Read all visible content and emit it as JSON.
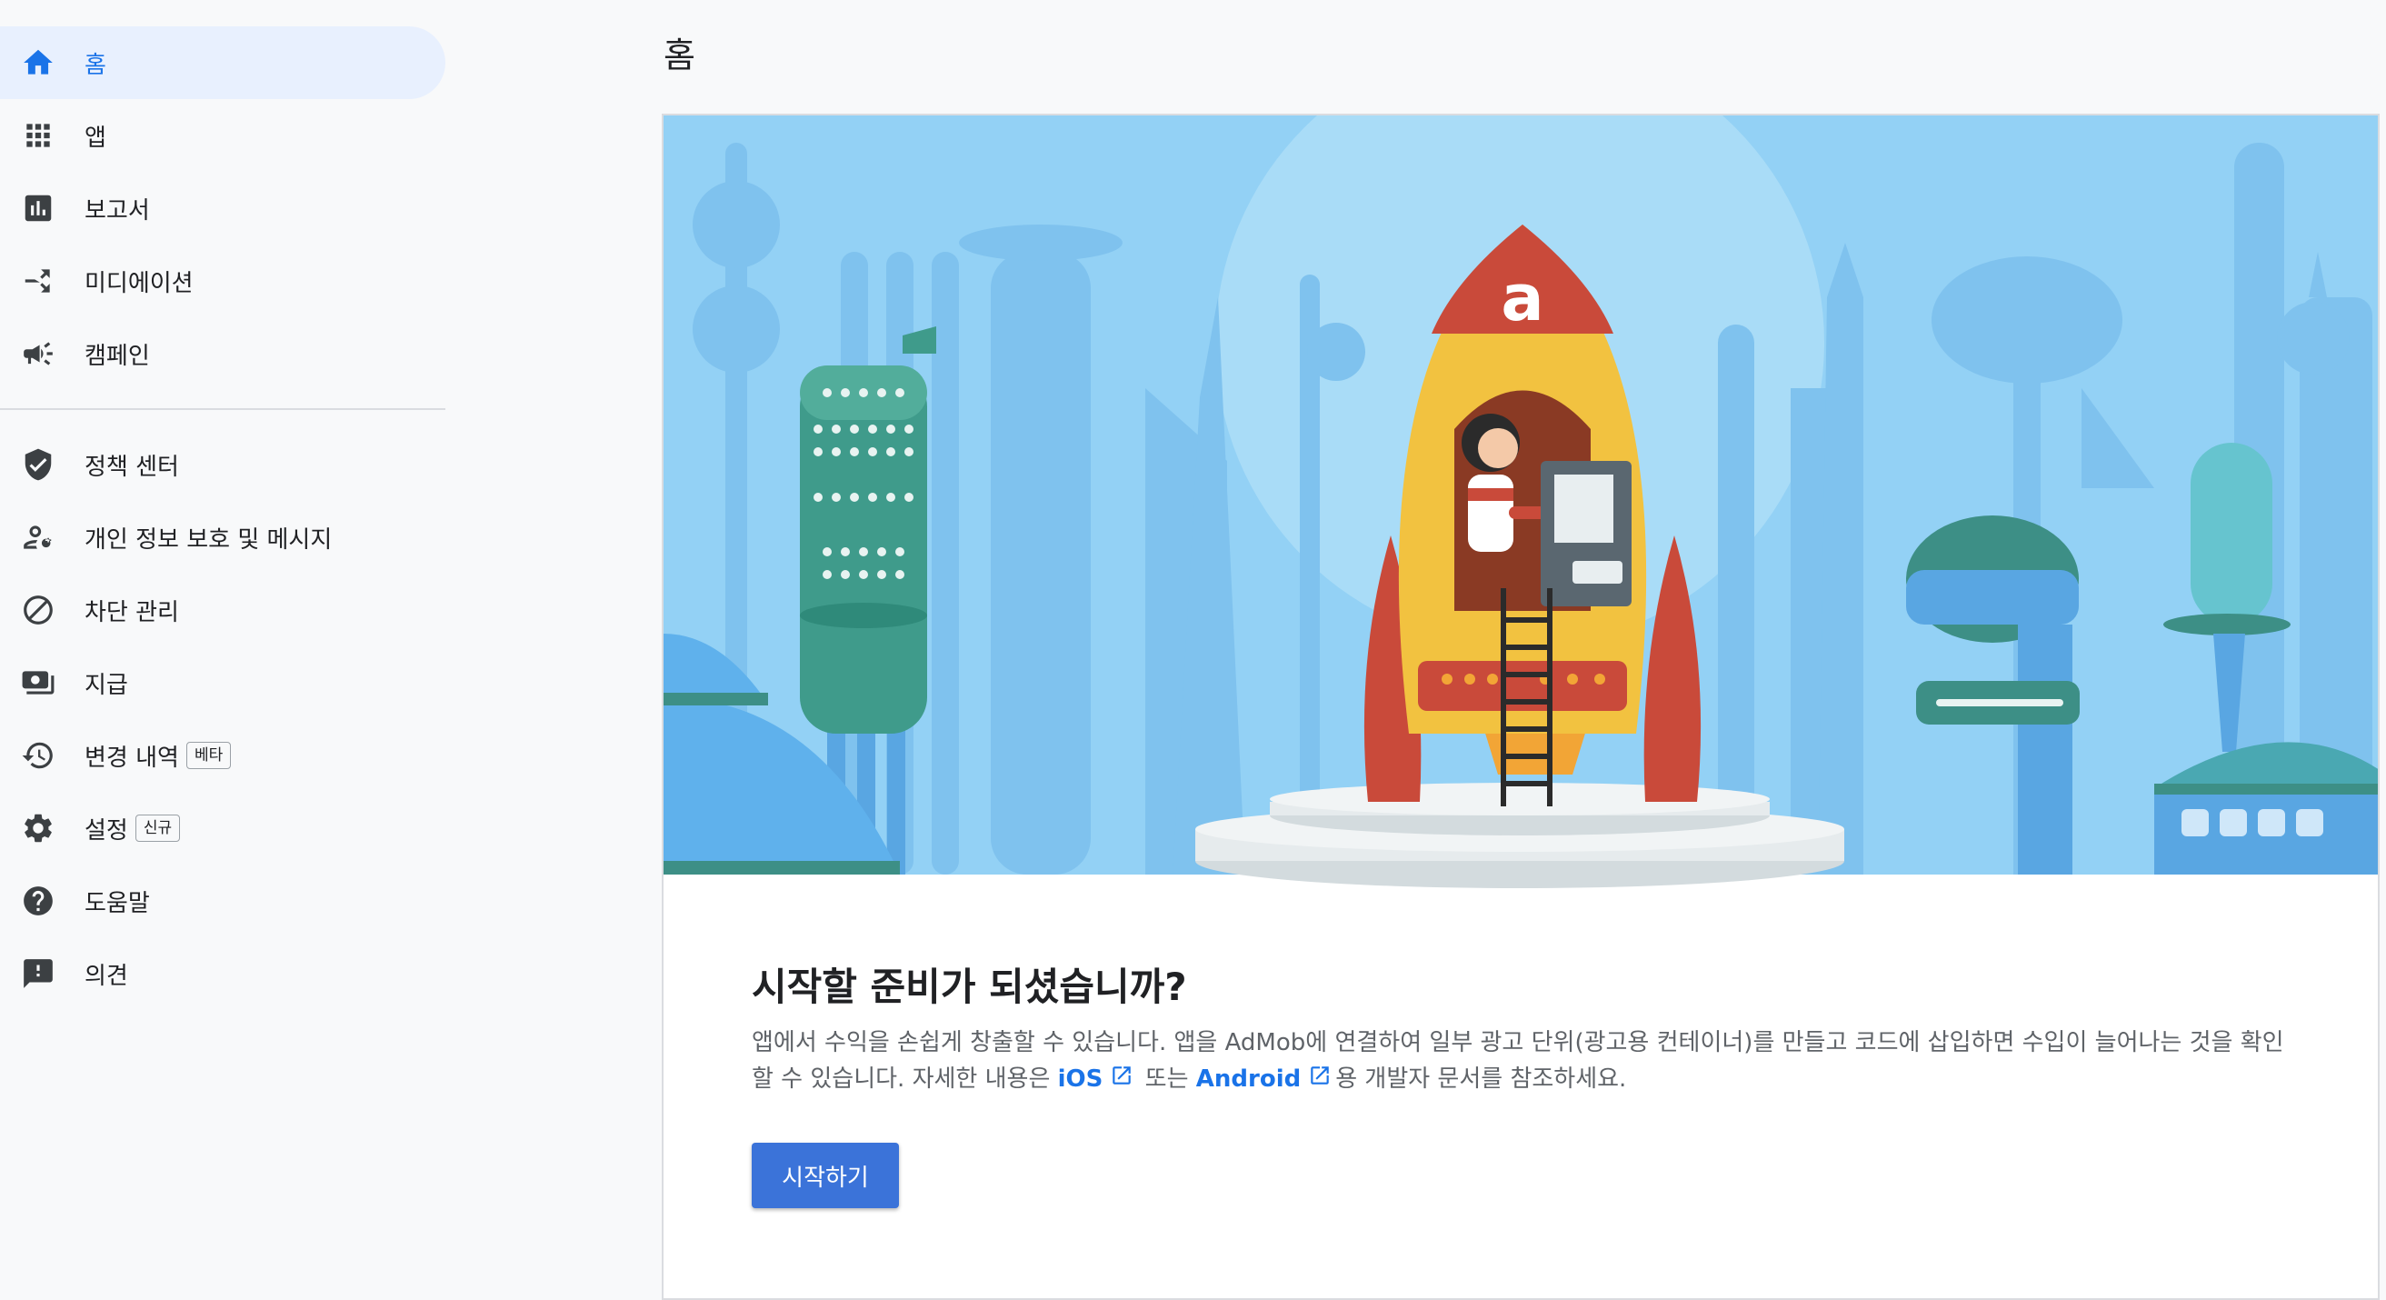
{
  "sidebar": {
    "items": [
      {
        "label": "홈",
        "icon": "home-icon",
        "active": true
      },
      {
        "label": "앱",
        "icon": "apps-grid-icon"
      },
      {
        "label": "보고서",
        "icon": "bar-chart-icon"
      },
      {
        "label": "미디에이션",
        "icon": "call-split-icon"
      },
      {
        "label": "캠페인",
        "icon": "megaphone-icon"
      },
      {
        "label": "정책 센터",
        "icon": "shield-check-icon"
      },
      {
        "label": "개인 정보 보호 및 메시지",
        "icon": "person-settings-icon"
      },
      {
        "label": "차단 관리",
        "icon": "block-icon"
      },
      {
        "label": "지급",
        "icon": "payments-icon"
      },
      {
        "label": "변경 내역",
        "icon": "history-icon",
        "tag": "베타"
      },
      {
        "label": "설정",
        "icon": "gear-icon",
        "tag": "신규"
      },
      {
        "label": "도움말",
        "icon": "help-icon"
      },
      {
        "label": "의견",
        "icon": "feedback-icon"
      }
    ]
  },
  "main": {
    "title": "홈",
    "card": {
      "heading": "시작할 준비가 되셨습니까?",
      "desc_part1": "앱에서 수익을 손쉽게 창출할 수 있습니다. 앱을 AdMob에 연결하여 일부 광고 단위(광고용 컨테이너)를 만들고 코드에 삽입하면 수입이 늘어나는 것을 확인할 수 있습니다. 자세한 내용은 ",
      "ios_link": "iOS",
      "desc_part2": " 또는 ",
      "android_link": "Android",
      "desc_part3": "용 개발자 문서를 참조하세요.",
      "button_label": "시작하기"
    }
  },
  "colors": {
    "accent": "#1a73e8",
    "button": "#3b73d9",
    "sky": "#93d1f5",
    "rocket_red": "#c94a3a",
    "rocket_yellow": "#f2c240"
  }
}
